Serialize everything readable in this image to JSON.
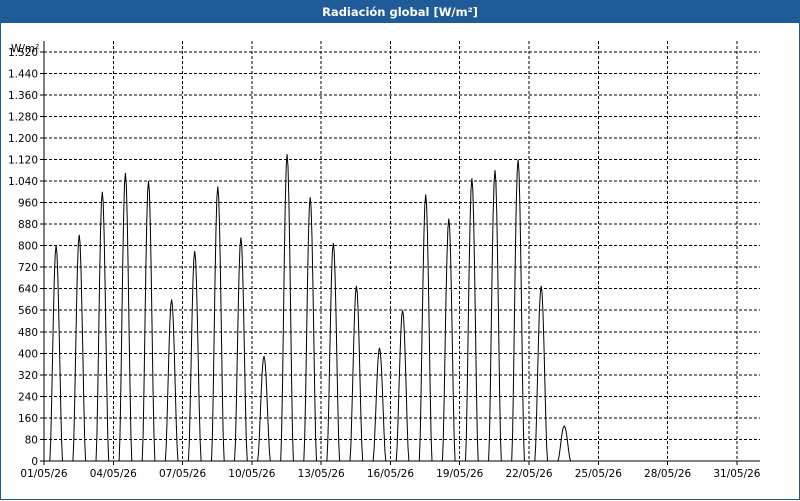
{
  "window": {
    "title": "Radiación global [W/m²]"
  },
  "chart_data": {
    "type": "line",
    "title": "Radiación global [W/m²]",
    "ylabel": "W/m²",
    "xlabel": "",
    "ylim": [
      0,
      1560
    ],
    "y_ticks": [
      "0",
      "80",
      "160",
      "240",
      "320",
      "400",
      "480",
      "560",
      "640",
      "720",
      "800",
      "880",
      "960",
      "1.040",
      "1.120",
      "1.200",
      "1.280",
      "1.360",
      "1.440",
      "1.520"
    ],
    "y_tick_values": [
      0,
      80,
      160,
      240,
      320,
      400,
      480,
      560,
      640,
      720,
      800,
      880,
      960,
      1040,
      1120,
      1200,
      1280,
      1360,
      1440,
      1520
    ],
    "xlim_days": [
      0,
      31
    ],
    "x_ticks": [
      "01/05/26",
      "04/05/26",
      "07/05/26",
      "10/05/26",
      "13/05/26",
      "16/05/26",
      "19/05/26",
      "22/05/26",
      "25/05/26",
      "28/05/26",
      "31/05/26"
    ],
    "x_tick_days": [
      0,
      3,
      6,
      9,
      12,
      15,
      18,
      21,
      24,
      27,
      30
    ],
    "grid": true,
    "line_color": "#000000",
    "series": [
      {
        "daily_peaks_w_m2": [
          800,
          840,
          1000,
          1070,
          1040,
          600,
          780,
          1020,
          830,
          390,
          1140,
          980,
          810,
          650,
          420,
          560,
          990,
          900,
          1050,
          1080,
          1120,
          650,
          130
        ]
      }
    ]
  }
}
